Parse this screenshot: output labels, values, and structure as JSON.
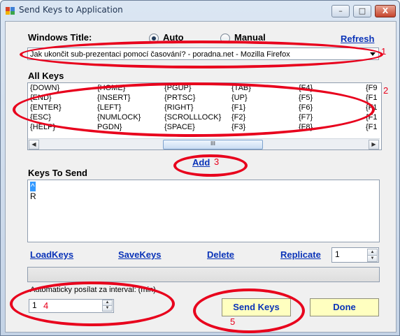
{
  "window": {
    "title": "Send Keys to Application",
    "minimize_glyph": "–",
    "maximize_glyph": "□",
    "close_glyph": "X"
  },
  "window_title_section": {
    "label": "Windows Title:",
    "mode_auto": "Auto",
    "mode_manual": "Manual",
    "selected_mode": "Auto",
    "refresh": "Refresh",
    "selected_window": "Jak ukončit sub-prezentaci pomocí časování? - poradna.net - Mozilla Firefox"
  },
  "all_keys": {
    "label": "All Keys",
    "columns": [
      [
        "{DOWN}",
        "{END}",
        "{ENTER}",
        "{ESC}",
        "{HELP}"
      ],
      [
        "{HOME}",
        "{INSERT}",
        "{LEFT}",
        "{NUMLOCK}",
        "PGDN}"
      ],
      [
        "{PGUP}",
        "{PRTSC}",
        "{RIGHT}",
        "{SCROLLLOCK}",
        "{SPACE}"
      ],
      [
        "{TAB}",
        "{UP}",
        "{F1}",
        "{F2}",
        "{F3}"
      ],
      [
        "{F4}",
        "{F5}",
        "{F6}",
        "{F7}",
        "{F8}"
      ],
      [
        "{F9",
        "{F1",
        "{F1",
        "{F1",
        "{F1"
      ]
    ],
    "scroll_thumb_glyph": "III"
  },
  "add_link": "Add",
  "keys_to_send": {
    "label": "Keys To Send",
    "items": [
      "^",
      "R"
    ],
    "selected_index": 0
  },
  "actions": {
    "load": "LoadKeys",
    "save": "SaveKeys",
    "delete": "Delete",
    "replicate": "Replicate",
    "replicate_count": "1"
  },
  "interval": {
    "label": "Automaticky posílat za interval: (min)",
    "value": "1"
  },
  "buttons": {
    "send": "Send Keys",
    "done": "Done"
  },
  "annotations": [
    "1",
    "2",
    "3",
    "4",
    "5"
  ],
  "colors": {
    "annotation": "#e8001c",
    "link": "#0a33b8",
    "button_bg": "#ffffc0",
    "selection": "#3399ff"
  }
}
